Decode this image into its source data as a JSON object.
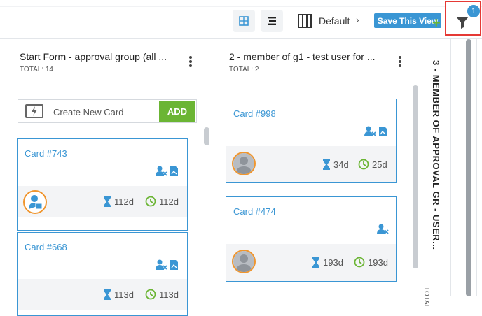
{
  "toolbar": {
    "view_name": "Default",
    "chevron": "›",
    "save_label": "Save This View",
    "filter_count": "1",
    "icons": [
      "grid-view-icon",
      "list-view-icon",
      "columns-icon",
      "filter-icon"
    ]
  },
  "colors": {
    "accent": "#3a96d4",
    "add_green": "#6bb534",
    "avatar_ring": "#f0962f",
    "highlight_red": "#e53935"
  },
  "columns": [
    {
      "title": "Start Form - approval group (all ...",
      "total": "TOTAL: 14",
      "create_card": {
        "placeholder": "Create New Card",
        "add_label": "ADD"
      },
      "cards": [
        {
          "title": "Card #743",
          "wait": "112d",
          "age": "112d"
        },
        {
          "title": "Card #668",
          "wait": "113d",
          "age": "113d"
        }
      ]
    },
    {
      "title": "2 - member of g1 - test user for ...",
      "total": "TOTAL: 2",
      "cards": [
        {
          "title": "Card #998",
          "wait": "34d",
          "age": "25d"
        },
        {
          "title": "Card #474",
          "wait": "193d",
          "age": "193d"
        }
      ]
    },
    {
      "title": "3 - MEMBER OF APPROVAL GR - USER...",
      "total": "TOTAL",
      "add_symbol": "+"
    }
  ]
}
